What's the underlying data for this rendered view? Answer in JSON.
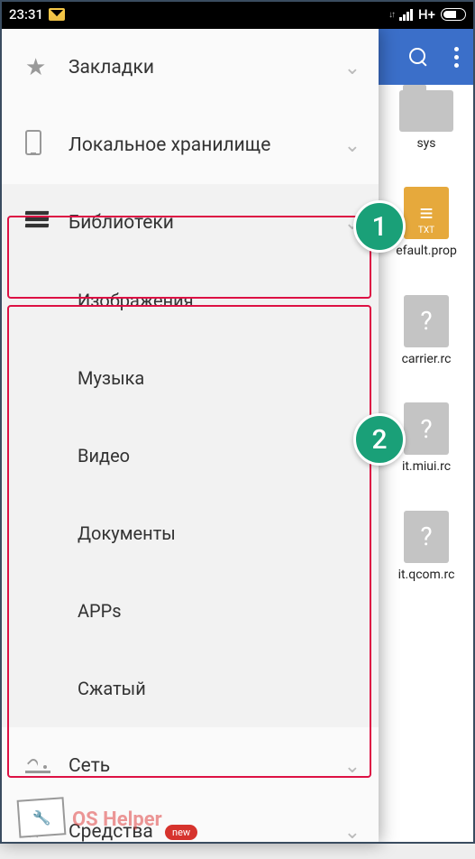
{
  "status": {
    "time": "23:31",
    "net_label": "H+",
    "data_arrows": "↓↑"
  },
  "toolbar": {
    "search": "search",
    "menu": "menu"
  },
  "drawer": {
    "bookmarks": "Закладки",
    "local_storage": "Локальное хранилище",
    "libraries": "Библиотеки",
    "sub": {
      "images": "Изображения",
      "music": "Музыка",
      "video": "Видео",
      "documents": "Документы",
      "apps": "APPs",
      "compressed": "Сжатый"
    },
    "network": "Сеть",
    "tools": "Средства",
    "new_badge": "new"
  },
  "annotations": {
    "badge1": "1",
    "badge2": "2"
  },
  "bg_files": {
    "f1": "sys",
    "f2_ext": "TXT",
    "f2_label": "efault.prop",
    "f3_label": "carrier.rc",
    "f4_label": "it.miui.rc",
    "f5_label": "it.qcom.rc"
  },
  "watermark": "OS Helper"
}
